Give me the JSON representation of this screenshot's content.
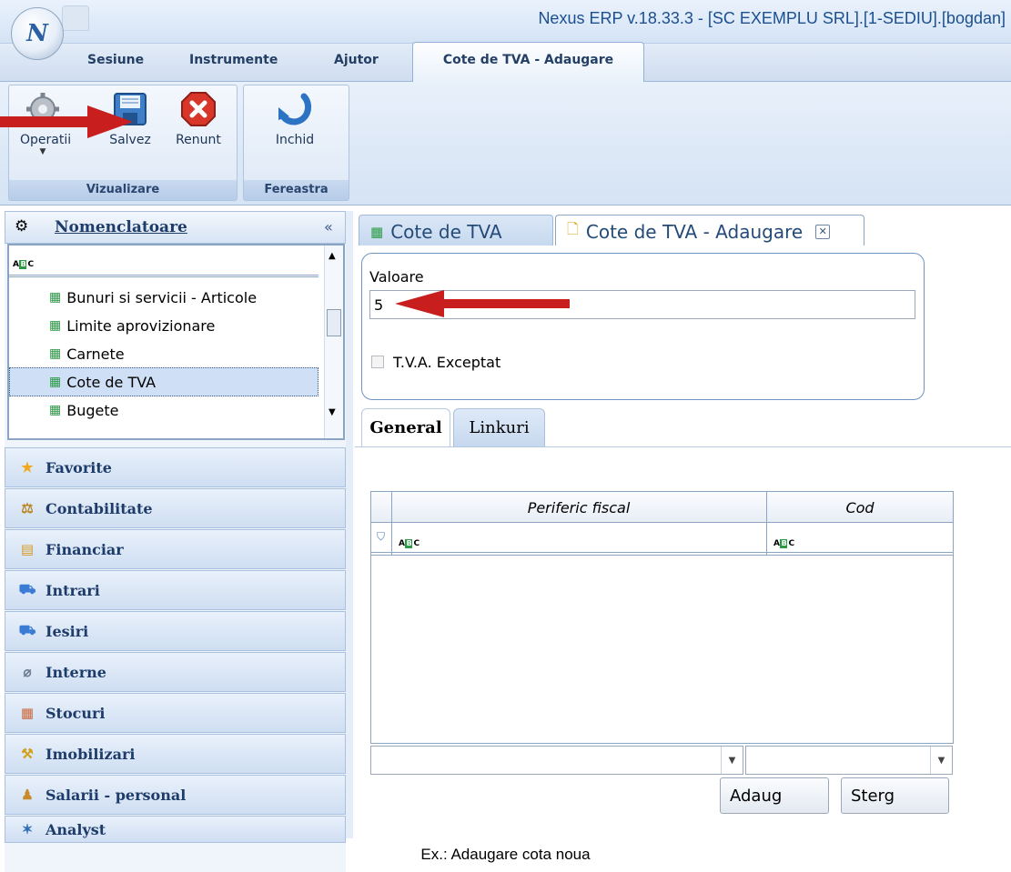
{
  "app": {
    "title": "Nexus ERP v.18.33.3 - [SC EXEMPLU SRL].[1-SEDIU].[bogdan]",
    "logo_letter": "N"
  },
  "menu": {
    "items": [
      "Sesiune",
      "Instrumente",
      "Ajutor"
    ],
    "active_tab": "Cote de TVA - Adaugare"
  },
  "ribbon": {
    "groups": [
      {
        "label": "Vizualizare",
        "buttons": [
          "Operatii",
          "Salvez",
          "Renunt"
        ]
      },
      {
        "label": "Fereastra",
        "buttons": [
          "Inchid"
        ]
      }
    ]
  },
  "sidebar": {
    "header": "Nomenclatoare",
    "collapse_glyph": "«",
    "filter_icon": "abc-filter-icon",
    "tree_items": [
      "Bunuri si servicii - Articole",
      "Limite aprovizionare",
      "Carnete",
      "Cote de TVA",
      "Bugete"
    ],
    "selected": "Cote de TVA",
    "nav": [
      "Favorite",
      "Contabilitate",
      "Financiar",
      "Intrari",
      "Iesiri",
      "Interne",
      "Stocuri",
      "Imobilizari",
      "Salarii - personal",
      "Analyst"
    ]
  },
  "doc_tabs": [
    "Cote de TVA",
    "Cote de TVA - Adaugare"
  ],
  "form": {
    "valoare_label": "Valoare",
    "valoare_value": "5",
    "exceptat_label": "T.V.A. Exceptat",
    "exceptat_checked": false,
    "subtabs": [
      "General",
      "Linkuri"
    ],
    "active_subtab": "General"
  },
  "grid": {
    "columns": [
      "Periferic fiscal",
      "Cod"
    ],
    "rows": []
  },
  "buttons": {
    "add": "Adaug",
    "delete": "Sterg"
  },
  "caption": "Ex.: Adaugare cota noua",
  "colors": {
    "accent": "#2b5fa3",
    "arrow": "#c81e1e",
    "selection": "#cfe0f6"
  }
}
